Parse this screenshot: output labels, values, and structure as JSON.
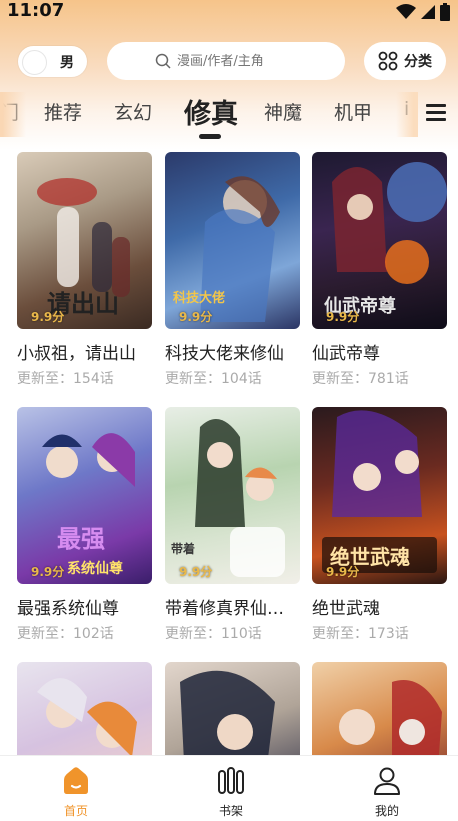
{
  "status_bar": {
    "time": "11:07"
  },
  "header": {
    "gender_toggle_label": "男",
    "search_placeholder": "漫画/作者/主角",
    "category_button_label": "分类"
  },
  "tabs": [
    {
      "label": "门",
      "partial": true
    },
    {
      "label": "推荐"
    },
    {
      "label": "玄幻"
    },
    {
      "label": "修真",
      "active": true
    },
    {
      "label": "神魔"
    },
    {
      "label": "机甲"
    },
    {
      "label": "i",
      "partial": true
    }
  ],
  "comics": [
    {
      "title": "小叔祖，请出山",
      "update": "更新至：154话",
      "rating": "9.9分"
    },
    {
      "title": "科技大佬来修仙",
      "update": "更新至：104话",
      "rating": "9.9分"
    },
    {
      "title": "仙武帝尊",
      "update": "更新至：781话",
      "rating": "9.9分"
    },
    {
      "title": "最强系统仙尊",
      "update": "更新至：102话",
      "rating": "9.9分"
    },
    {
      "title": "带着修真界仙…",
      "update": "更新至：110话",
      "rating": "9.9分"
    },
    {
      "title": "绝世武魂",
      "update": "更新至：173话",
      "rating": "9.9分"
    },
    {
      "title": "",
      "update": "",
      "rating": ""
    },
    {
      "title": "",
      "update": "",
      "rating": ""
    },
    {
      "title": "",
      "update": "",
      "rating": ""
    }
  ],
  "bottom_nav": [
    {
      "label": "首页",
      "icon": "home-icon",
      "active": true
    },
    {
      "label": "书架",
      "icon": "bookshelf-icon"
    },
    {
      "label": "我的",
      "icon": "user-icon"
    }
  ],
  "colors": {
    "accent": "#f0942b",
    "rating": "#e9b84a",
    "header_gradient_top": "#f6c48a"
  }
}
